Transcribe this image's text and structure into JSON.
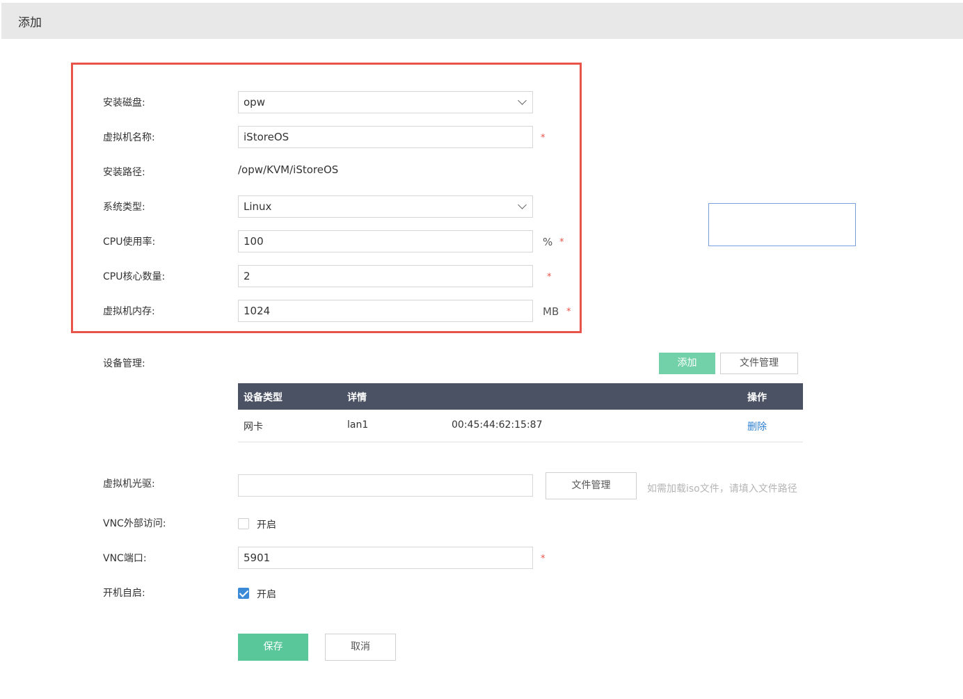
{
  "header": {
    "title": "添加"
  },
  "form": {
    "disk": {
      "label": "安装磁盘:",
      "value": "opw"
    },
    "vm_name": {
      "label": "虚拟机名称:",
      "value": "iStoreOS",
      "required": "*"
    },
    "path": {
      "label": "安装路径:",
      "value": "/opw/KVM/iStoreOS"
    },
    "os_type": {
      "label": "系统类型:",
      "value": "Linux"
    },
    "cpu_usage": {
      "label": "CPU使用率:",
      "value": "100",
      "unit": "%",
      "required": "*"
    },
    "cpu_cores": {
      "label": "CPU核心数量:",
      "value": "2",
      "required": "*"
    },
    "memory": {
      "label": "虚拟机内存:",
      "value": "1024",
      "unit": "MB",
      "required": "*"
    }
  },
  "devices": {
    "label": "设备管理:",
    "add_button": "添加",
    "file_button": "文件管理",
    "columns": {
      "type": "设备类型",
      "detail": "详情",
      "action": "操作"
    },
    "rows": [
      {
        "type": "网卡",
        "detail": "lan1",
        "mac": "00:45:44:62:15:87",
        "action": "删除"
      }
    ]
  },
  "cdrom": {
    "label": "虚拟机光驱:",
    "value": "",
    "file_button": "文件管理",
    "hint": "如需加载iso文件，请填入文件路径"
  },
  "vnc_access": {
    "label": "VNC外部访问:",
    "option": "开启",
    "checked": false
  },
  "vnc_port": {
    "label": "VNC端口:",
    "value": "5901",
    "required": "*"
  },
  "autostart": {
    "label": "开机自启:",
    "option": "开启",
    "checked": true
  },
  "actions": {
    "save": "保存",
    "cancel": "取消"
  },
  "colors": {
    "accent": "#5ac79b",
    "highlight": "#e8534a",
    "table_header": "#4b5263",
    "link": "#2d7fd0"
  }
}
